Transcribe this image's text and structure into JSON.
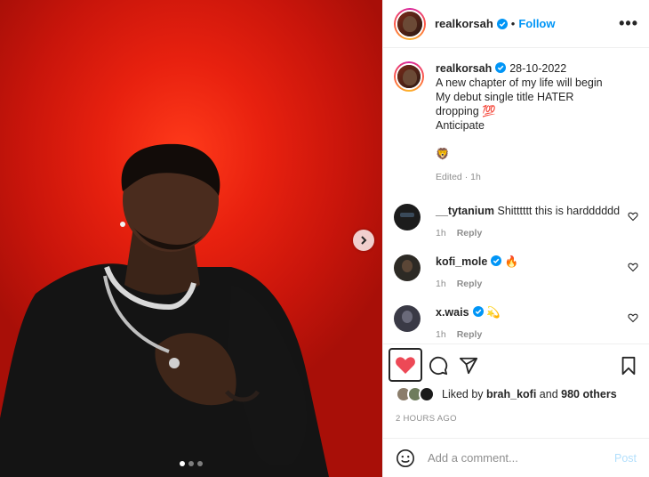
{
  "post": {
    "username": "realkorsah",
    "follow_label": "Follow",
    "more_label": "•••",
    "carousel_dots": 3,
    "active_dot": 0
  },
  "caption": {
    "username": "realkorsah",
    "date": "28-10-2022",
    "lines": [
      "A new chapter of my life will begin",
      "My debut single title HATER",
      "dropping 💯",
      "Anticipate"
    ],
    "emoji": "🦁",
    "meta": "Edited · 1h"
  },
  "comments": [
    {
      "username": "__tytanium",
      "text": "Shitttttt this is hardddddd",
      "time": "1h",
      "reply": "Reply",
      "verified": false,
      "avatar_color": "#1c1c1c"
    },
    {
      "username": "kofi_mole",
      "text": "🔥",
      "time": "1h",
      "reply": "Reply",
      "verified": true,
      "avatar_color": "#2d2a25"
    },
    {
      "username": "x.wais",
      "text": "💫",
      "time": "1h",
      "reply": "Reply",
      "verified": true,
      "avatar_color": "#3a3a46"
    }
  ],
  "likes": {
    "prefix": "Liked by",
    "user": "brah_kofi",
    "joiner": "and",
    "others": "980 others"
  },
  "timestamp": "2 HOURS AGO",
  "add_comment": {
    "placeholder": "Add a comment...",
    "post_label": "Post"
  },
  "colors": {
    "accent": "#0095f6",
    "like_red": "#ed4956",
    "muted": "#8e8e8e"
  }
}
